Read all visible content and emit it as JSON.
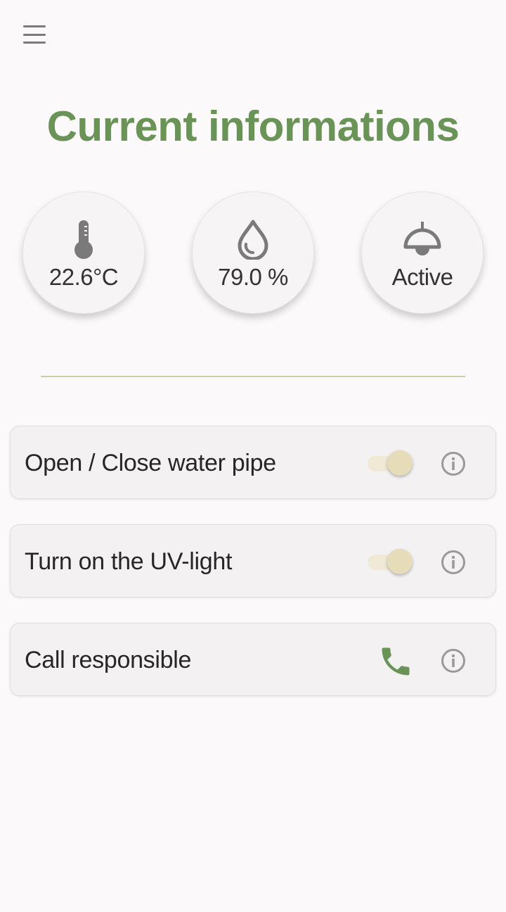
{
  "header": {
    "menu_icon": "hamburger-menu-icon",
    "title": "Current informations"
  },
  "stats": [
    {
      "icon": "thermometer-icon",
      "value": "22.6°C"
    },
    {
      "icon": "water-drop-icon",
      "value": "79.0 %"
    },
    {
      "icon": "ceiling-lamp-icon",
      "value": "Active"
    }
  ],
  "controls": [
    {
      "label": "Open / Close water pipe",
      "type": "toggle",
      "on": true,
      "info_icon": "info-icon"
    },
    {
      "label": "Turn on the UV-light",
      "type": "toggle",
      "on": true,
      "info_icon": "info-icon"
    },
    {
      "label": "Call responsible",
      "type": "call",
      "action_icon": "phone-icon",
      "info_icon": "info-icon"
    }
  ],
  "colors": {
    "accent": "#6a9357",
    "background": "#fbf9f9",
    "divider": "#c5d0a4",
    "toggle_thumb": "#e6dcba",
    "toggle_track": "#f0e9d6",
    "icon_gray": "#7a7a7a"
  }
}
